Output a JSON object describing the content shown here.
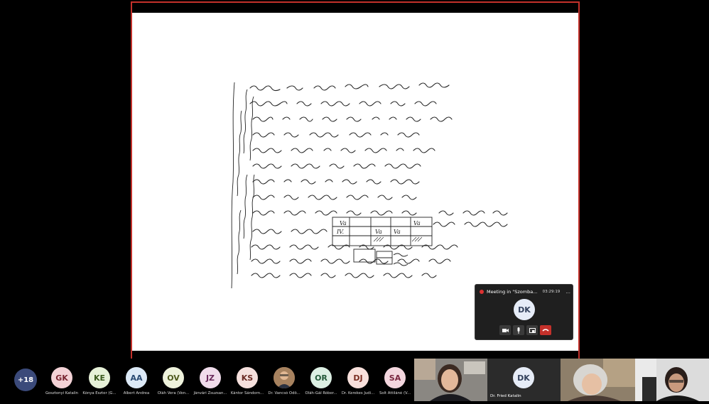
{
  "screen_share": {},
  "pip": {
    "title": "Meeting in \"Szomba...",
    "time": "03:29:19",
    "more": "...",
    "initials": "DK"
  },
  "participants": {
    "overflow": "+18",
    "list": [
      {
        "initials": "GK",
        "name": "Gosztonyi Katalin",
        "bg": "#f3d2d6",
        "fg": "#7a2632"
      },
      {
        "initials": "KE",
        "name": "Kónya Eszter (G...",
        "bg": "#e6f1d8",
        "fg": "#3b5a1e"
      },
      {
        "initials": "AA",
        "name": "Albert Andrea",
        "bg": "#dce9f6",
        "fg": "#2a4a73"
      },
      {
        "initials": "OV",
        "name": "Oláh Vera (Ven...",
        "bg": "#eef2dc",
        "fg": "#4f5a1e"
      },
      {
        "initials": "JZ",
        "name": "Jánvári Zsuzsan...",
        "bg": "#f0dceb",
        "fg": "#6a2a5c"
      },
      {
        "initials": "KS",
        "name": "Kántor Sándorn...",
        "bg": "#f5e0dd",
        "fg": "#6b2b24"
      },
      {
        "initials": "",
        "name": "Dr. Vancsó Ödö...",
        "bg": "#8a6a4e",
        "fg": "#fff"
      },
      {
        "initials": "OR",
        "name": "Oláh-Gál Róber...",
        "bg": "#dcefe3",
        "fg": "#245a3a"
      },
      {
        "initials": "DJ",
        "name": "Dr. Kerekes Judi...",
        "bg": "#f8e0dc",
        "fg": "#7a2d22"
      },
      {
        "initials": "SA",
        "name": "Solt Attiláné (V...",
        "bg": "#f3d6de",
        "fg": "#7a2640"
      }
    ]
  },
  "video_tiles": {
    "fried": {
      "initials": "DK",
      "label": "Dr. Fried Katalin"
    }
  }
}
